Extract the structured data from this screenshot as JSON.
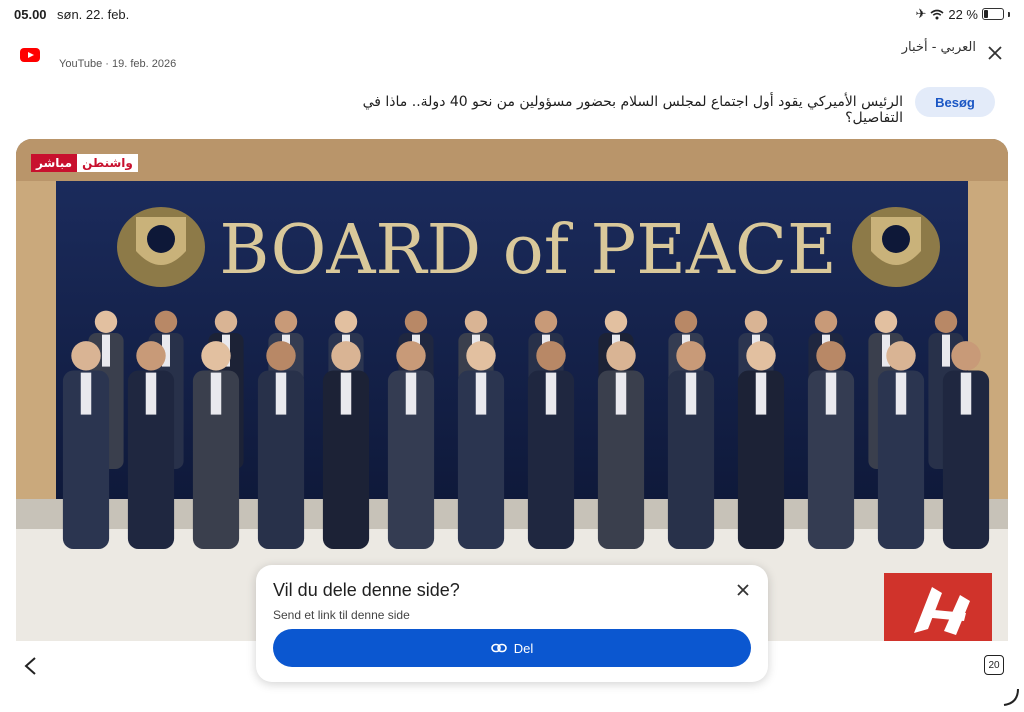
{
  "status_bar": {
    "time": "05.00",
    "date": "søn. 22. feb.",
    "battery_percent": "22 %",
    "battery_level": 0.22
  },
  "article": {
    "source_icon": "youtube-icon",
    "source_line": "YouTube · 19. feb. 2026",
    "channel": "العربي - أخبار",
    "visit_label": "Besøg",
    "headline": "الرئيس الأميركي يقود أول اجتماع لمجلس السلام بحضور مسؤولين من نحو 40 دولة.. ماذا في التفاصيل؟"
  },
  "image": {
    "banner_text": "BOARD of PEACE",
    "live_badge_red": "مباشر",
    "live_badge_white": "واشنطن",
    "colors": {
      "backdrop": "#14224d",
      "gold": "#c9b27a",
      "floor": "#e8e6e1"
    }
  },
  "share_sheet": {
    "title": "Vil du dele denne side?",
    "subtitle": "Send et link til denne side",
    "button_label": "Del",
    "button_color": "#0b57d0"
  },
  "toolbar": {
    "tab_count": "20"
  }
}
